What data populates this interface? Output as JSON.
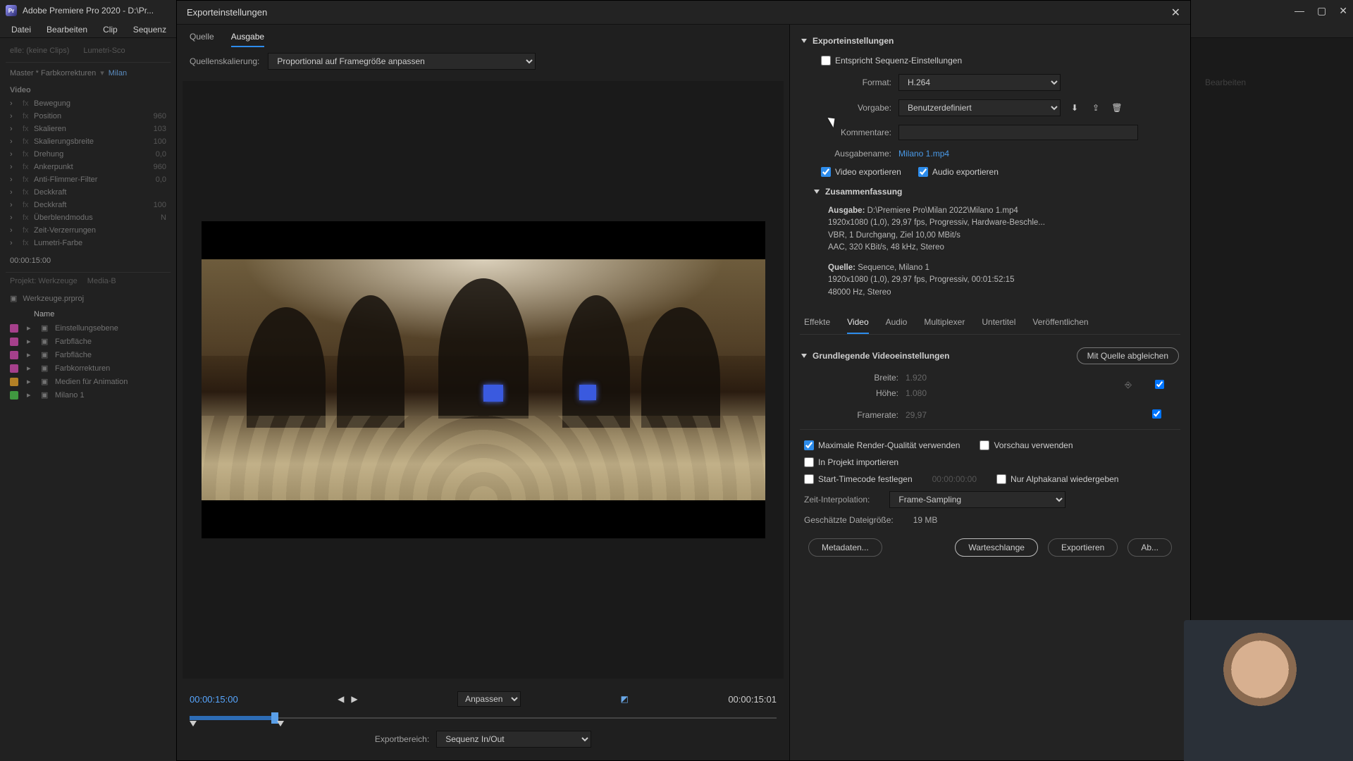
{
  "titlebar": {
    "text": "Adobe Premiere Pro 2020 - D:\\Pr..."
  },
  "menubar": [
    "Datei",
    "Bearbeiten",
    "Clip",
    "Sequenz"
  ],
  "bg": {
    "panel_tabs": [
      "elle: (keine Clips)",
      "Lumetri-Sco"
    ],
    "master": "Master * Farbkorrekturen",
    "clip_link": "Milan",
    "video_label": "Video",
    "effects": [
      {
        "name": "Bewegung",
        "val": ""
      },
      {
        "name": "Position",
        "val": "960"
      },
      {
        "name": "Skalieren",
        "val": "103"
      },
      {
        "name": "Skalierungsbreite",
        "val": "100"
      },
      {
        "name": "Drehung",
        "val": "0,0"
      },
      {
        "name": "Ankerpunkt",
        "val": "960"
      },
      {
        "name": "Anti-Flimmer-Filter",
        "val": "0,0"
      },
      {
        "name": "Deckkraft",
        "val": ""
      },
      {
        "name": "Deckkraft",
        "val": "100"
      },
      {
        "name": "Überblendmodus",
        "val": "N"
      },
      {
        "name": "Zeit-Verzerrungen",
        "val": ""
      },
      {
        "name": "Lumetri-Farbe",
        "val": ""
      }
    ],
    "tc": "00:00:15:00",
    "project_tabs": [
      "Projekt: Werkzeuge",
      "Media-B"
    ],
    "project_file": "Werkzeuge.prproj",
    "col_name": "Name",
    "items": [
      {
        "color": "#c84aa8",
        "name": "Einstellungsebene"
      },
      {
        "color": "#c84aa8",
        "name": "Farbfläche"
      },
      {
        "color": "#c84aa8",
        "name": "Farbfläche"
      },
      {
        "color": "#c84aa8",
        "name": "Farbkorrekturen"
      },
      {
        "color": "#d89a2a",
        "name": "Medien für Animation"
      },
      {
        "color": "#4ab84a",
        "name": "Milano 1"
      }
    ],
    "right_tab": "Bearbeiten"
  },
  "dialog": {
    "title": "Exporteinstellungen",
    "left": {
      "tabs": [
        "Quelle",
        "Ausgabe"
      ],
      "active_tab": 1,
      "scaling_label": "Quellenskalierung:",
      "scaling_value": "Proportional auf Framegröße anpassen",
      "tc_current": "00:00:15:00",
      "tc_total": "00:00:15:01",
      "fit_label": "Anpassen",
      "range_label": "Exportbereich:",
      "range_value": "Sequenz In/Out"
    },
    "right": {
      "section1": "Exporteinstellungen",
      "match_seq": "Entspricht Sequenz-Einstellungen",
      "format_label": "Format:",
      "format_value": "H.264",
      "preset_label": "Vorgabe:",
      "preset_value": "Benutzerdefiniert",
      "comments_label": "Kommentare:",
      "comments_value": "",
      "outname_label": "Ausgabename:",
      "outname_value": "Milano 1.mp4",
      "export_video": "Video exportieren",
      "export_audio": "Audio exportieren",
      "summary_head": "Zusammenfassung",
      "summary_out_label": "Ausgabe:",
      "summary_out": "D:\\Premiere Pro\\Milan 2022\\Milano 1.mp4\n1920x1080 (1,0), 29,97 fps, Progressiv, Hardware-Beschle...\nVBR, 1 Durchgang, Ziel 10,00 MBit/s\nAAC, 320 KBit/s, 48 kHz, Stereo",
      "summary_src_label": "Quelle:",
      "summary_src": "Sequence, Milano 1\n1920x1080 (1,0), 29,97 fps, Progressiv, 00:01:52:15\n48000 Hz, Stereo",
      "tabs2": [
        "Effekte",
        "Video",
        "Audio",
        "Multiplexer",
        "Untertitel",
        "Veröffentlichen"
      ],
      "tabs2_active": 1,
      "basic_video": "Grundlegende Videoeinstellungen",
      "match_source": "Mit Quelle abgleichen",
      "width_label": "Breite:",
      "width_value": "1.920",
      "height_label": "Höhe:",
      "height_value": "1.080",
      "fps_label": "Framerate:",
      "fps_value": "29,97",
      "max_quality": "Maximale Render-Qualität verwenden",
      "use_preview": "Vorschau verwenden",
      "import_project": "In Projekt importieren",
      "start_tc": "Start-Timecode festlegen",
      "start_tc_val": "00:00:00:00",
      "alpha_only": "Nur Alphakanal wiedergeben",
      "time_interp_label": "Zeit-Interpolation:",
      "time_interp_value": "Frame-Sampling",
      "est_size_label": "Geschätzte Dateigröße:",
      "est_size_value": "19 MB",
      "btn_metadata": "Metadaten...",
      "btn_queue": "Warteschlange",
      "btn_export": "Exportieren",
      "btn_cancel": "Ab..."
    }
  }
}
